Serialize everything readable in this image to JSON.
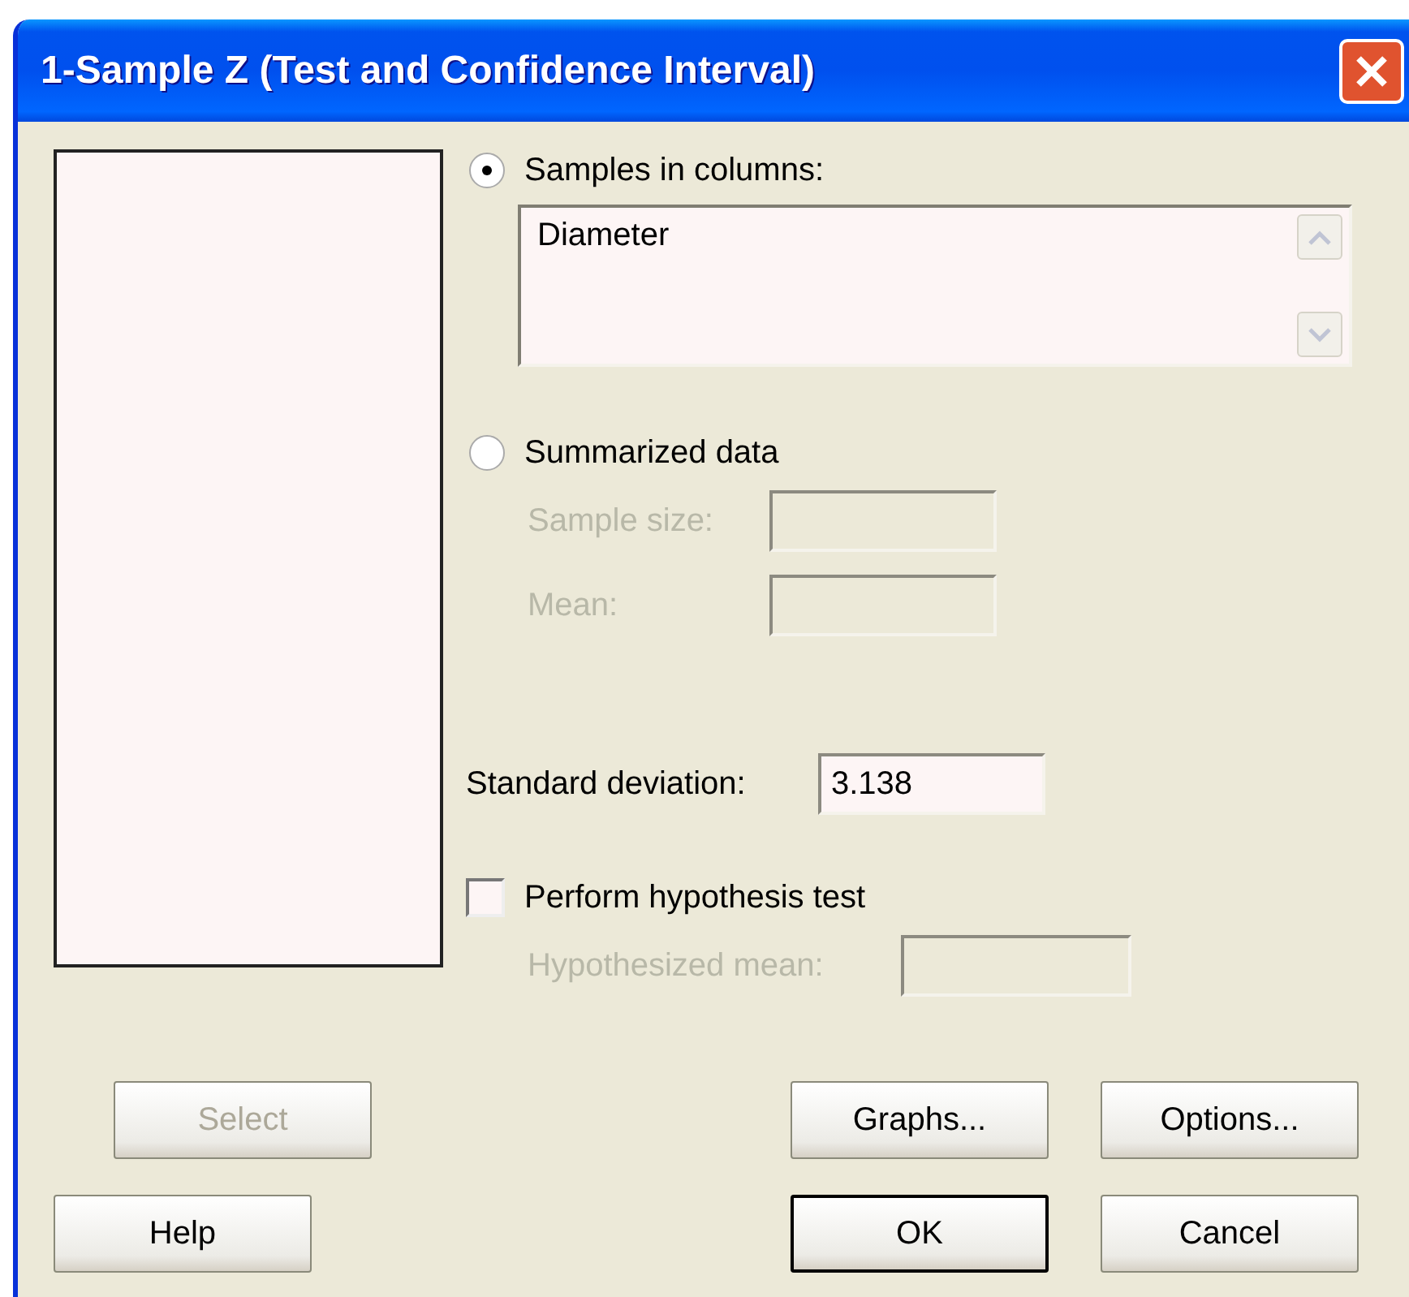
{
  "window": {
    "title": "1-Sample Z (Test and Confidence Interval)"
  },
  "input_modes": [
    {
      "label": "Samples in columns:",
      "selected": true
    },
    {
      "label": "Summarized data",
      "selected": false
    }
  ],
  "samples_field": {
    "values": [
      "Diameter"
    ]
  },
  "summarized_fields": [
    {
      "label": "Sample size:",
      "disabled": true
    },
    {
      "label": "Mean:",
      "disabled": true
    }
  ],
  "standard_deviation": {
    "label": "Standard deviation:",
    "value": "3.138"
  },
  "hypothesis_test": {
    "label": "Perform hypothesis test",
    "checked": false
  },
  "hypothesized_mean": {
    "label": "Hypothesized mean:",
    "disabled": true
  },
  "buttons": [
    {
      "label": "Select",
      "disabled": true,
      "default": false
    },
    {
      "label": "Graphs...",
      "disabled": false,
      "default": false
    },
    {
      "label": "Options...",
      "disabled": false,
      "default": false
    },
    {
      "label": "Help",
      "disabled": false,
      "default": false
    },
    {
      "label": "OK",
      "disabled": false,
      "default": true
    },
    {
      "label": "Cancel",
      "disabled": false,
      "default": false
    }
  ]
}
